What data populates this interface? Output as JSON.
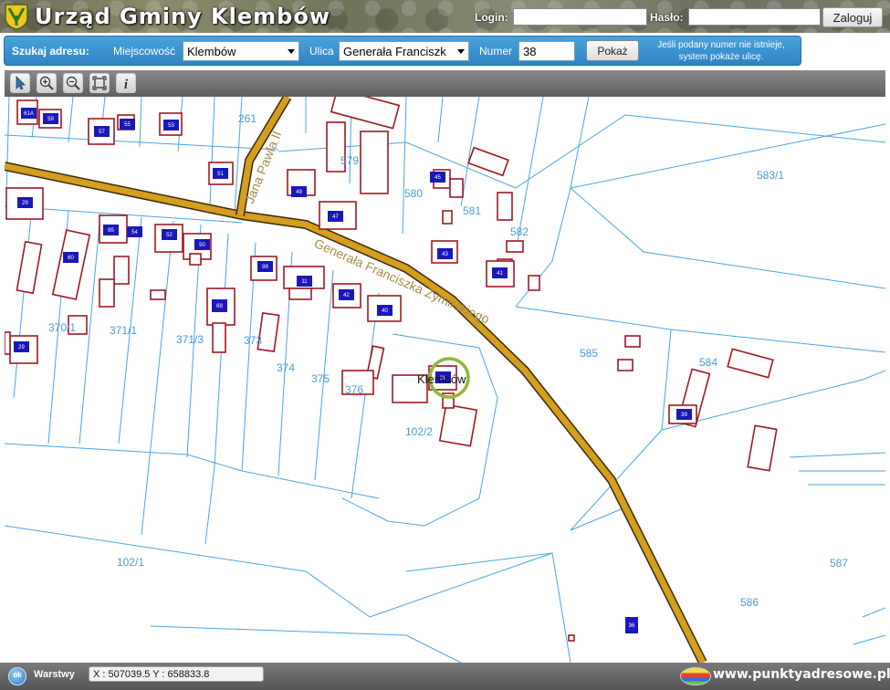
{
  "header": {
    "title": "Urząd Gminy Klembów",
    "login_label": "Login:",
    "password_label": "Hasło:",
    "login_value": "",
    "password_value": "",
    "login_button": "Zaloguj"
  },
  "search": {
    "title": "Szukaj adresu:",
    "locality_label": "Miejscowość",
    "locality_value": "Klembów",
    "street_label": "Ulica",
    "street_value": "Generała Franciszk",
    "number_label": "Numer",
    "number_value": "38",
    "show_button": "Pokaż",
    "hint_line1": "Jeśli podany numer nie istnieje,",
    "hint_line2": "system pokaże ulicę."
  },
  "toolbar": {
    "tools": [
      "pointer-icon",
      "zoom-in-icon",
      "zoom-out-icon",
      "full-extent-icon",
      "info-icon"
    ]
  },
  "map": {
    "roads": [
      "Jana Pawła II",
      "Generała Franciszka Żymirskiego"
    ],
    "parcel_labels": [
      "261",
      "579",
      "583/1",
      "580",
      "581",
      "582",
      "370/1",
      "371/1",
      "371/3",
      "373",
      "374",
      "375",
      "376",
      "585",
      "584",
      "102/2",
      "102/1",
      "587",
      "586"
    ],
    "building_numbers": [
      "61A",
      "59",
      "57",
      "55",
      "53",
      "51",
      "49",
      "47",
      "45",
      "43",
      "41",
      "29",
      "95",
      "54",
      "52",
      "50",
      "60",
      "99",
      "11",
      "42",
      "40",
      "69",
      "38",
      "39",
      "36"
    ],
    "highlight_label": "Klembów",
    "colors": {
      "road": "#d49e1e",
      "parcel": "#4aa3e6",
      "building": "#9e1822",
      "number": "#1a18b8",
      "highlight": "#8fb83a"
    }
  },
  "footer": {
    "layers_icon_text": "ok",
    "layers_label": "Warstwy",
    "coords": "X : 507039.5  Y : 658833.8",
    "url": "www.punktyadresowe.pl"
  }
}
